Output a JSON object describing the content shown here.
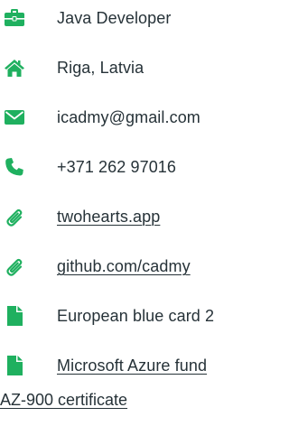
{
  "colors": {
    "accent": "#1fb05f",
    "text": "#263238"
  },
  "contacts": [
    {
      "icon": "briefcase-icon",
      "text": "Java Developer",
      "link": false
    },
    {
      "icon": "home-icon",
      "text": "Riga, Latvia",
      "link": false
    },
    {
      "icon": "envelope-icon",
      "text": "icadmy@gmail.com",
      "link": false
    },
    {
      "icon": "phone-icon",
      "text": "+371 262 97016",
      "link": false
    },
    {
      "icon": "paperclip-icon",
      "text": "twohearts.app",
      "link": true
    },
    {
      "icon": "paperclip-icon",
      "text": "github.com/cadmy",
      "link": true
    },
    {
      "icon": "file-icon",
      "text": "European blue card 2",
      "link": false
    },
    {
      "icon": "file-icon",
      "text": "Microsoft Azure fund",
      "link": true
    }
  ],
  "continuation": "AZ-900 certificate"
}
